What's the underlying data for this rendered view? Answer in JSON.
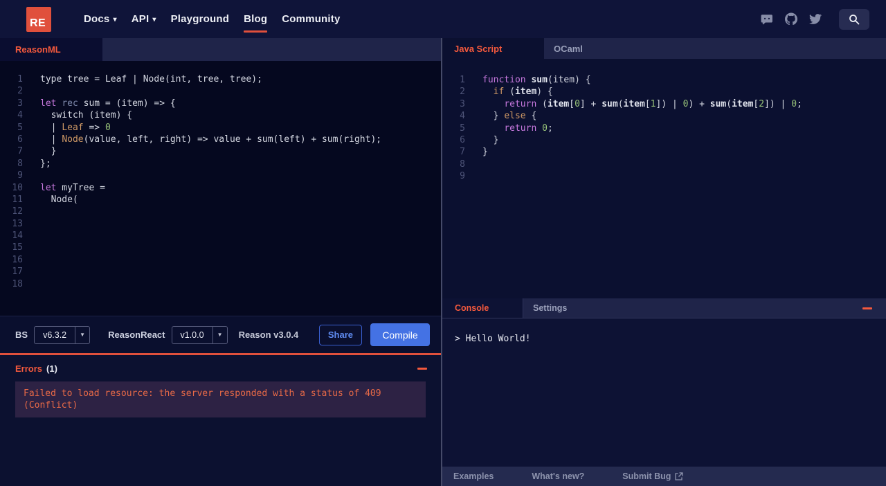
{
  "navbar": {
    "logo_text": "RE",
    "items": [
      {
        "label": "Docs",
        "dropdown": true,
        "active": false
      },
      {
        "label": "API",
        "dropdown": true,
        "active": false
      },
      {
        "label": "Playground",
        "dropdown": false,
        "active": false
      },
      {
        "label": "Blog",
        "dropdown": false,
        "active": true
      },
      {
        "label": "Community",
        "dropdown": false,
        "active": false
      }
    ],
    "icons": [
      "discord-icon",
      "github-icon",
      "twitter-icon",
      "search-icon"
    ]
  },
  "left": {
    "tabs": [
      {
        "label": "ReasonML",
        "active": true
      }
    ],
    "editor": {
      "language": "reason",
      "lines": [
        [
          [
            "p",
            "type tree = Leaf | Node(int, tree, tree);"
          ]
        ],
        [],
        [
          [
            "k",
            "let"
          ],
          [
            "p",
            " "
          ],
          [
            "r",
            "rec"
          ],
          [
            "p",
            " sum = (item) => {"
          ]
        ],
        [
          [
            "p",
            "  switch (item) {"
          ]
        ],
        [
          [
            "p",
            "  | "
          ],
          [
            "o",
            "Leaf"
          ],
          [
            "p",
            " => "
          ],
          [
            "n",
            "0"
          ]
        ],
        [
          [
            "p",
            "  | "
          ],
          [
            "o",
            "Node"
          ],
          [
            "p",
            "(value, left, right) => value + sum(left) + sum(right);"
          ]
        ],
        [
          [
            "p",
            "  }"
          ]
        ],
        [
          [
            "p",
            "};"
          ]
        ],
        [],
        [
          [
            "k",
            "let"
          ],
          [
            "p",
            " myTree ="
          ]
        ],
        [
          [
            "p",
            "  Node("
          ]
        ],
        [],
        [],
        [],
        [],
        [],
        [],
        []
      ]
    },
    "toolbar": {
      "bs_label": "BS",
      "bs_version": "v6.3.2",
      "reasonreact_label": "ReasonReact",
      "reasonreact_version": "v1.0.0",
      "reason_version": "Reason v3.0.4",
      "share_label": "Share",
      "compile_label": "Compile"
    },
    "errors": {
      "title": "Errors",
      "count": "(1)",
      "message_line1": "Failed to load resource: the server responded with a status of 409",
      "message_line2": "(Conflict)"
    }
  },
  "right": {
    "tabs": [
      {
        "label": "Java Script",
        "active": true
      },
      {
        "label": "OCaml",
        "active": false
      }
    ],
    "editor": {
      "language": "javascript",
      "lines": [
        [
          [
            "k",
            "function"
          ],
          [
            "p",
            " "
          ],
          [
            "b",
            "sum"
          ],
          [
            "p",
            "(item) {"
          ]
        ],
        [
          [
            "p",
            "  "
          ],
          [
            "o",
            "if"
          ],
          [
            "p",
            " ("
          ],
          [
            "b",
            "item"
          ],
          [
            "p",
            ") {"
          ]
        ],
        [
          [
            "p",
            "    "
          ],
          [
            "k",
            "return"
          ],
          [
            "p",
            " ("
          ],
          [
            "b",
            "item"
          ],
          [
            "p",
            "["
          ],
          [
            "n",
            "0"
          ],
          [
            "p",
            "] + "
          ],
          [
            "b",
            "sum"
          ],
          [
            "p",
            "("
          ],
          [
            "b",
            "item"
          ],
          [
            "p",
            "["
          ],
          [
            "n",
            "1"
          ],
          [
            "p",
            "]) | "
          ],
          [
            "n",
            "0"
          ],
          [
            "p",
            ") + "
          ],
          [
            "b",
            "sum"
          ],
          [
            "p",
            "("
          ],
          [
            "b",
            "item"
          ],
          [
            "p",
            "["
          ],
          [
            "n",
            "2"
          ],
          [
            "p",
            "]) | "
          ],
          [
            "n",
            "0"
          ],
          [
            "p",
            ";"
          ]
        ],
        [
          [
            "p",
            "  } "
          ],
          [
            "o",
            "else"
          ],
          [
            "p",
            " {"
          ]
        ],
        [
          [
            "p",
            "    "
          ],
          [
            "k",
            "return"
          ],
          [
            "p",
            " "
          ],
          [
            "n",
            "0"
          ],
          [
            "p",
            ";"
          ]
        ],
        [
          [
            "p",
            "  }"
          ]
        ],
        [
          [
            "p",
            "}"
          ]
        ],
        [],
        []
      ]
    },
    "console": {
      "tabs": [
        {
          "label": "Console",
          "active": true
        },
        {
          "label": "Settings",
          "active": false
        }
      ],
      "output": "> Hello World!"
    },
    "footer": {
      "items": [
        "Examples",
        "What's new?",
        "Submit Bug"
      ]
    }
  },
  "colors": {
    "accent_orange": "#f4593d",
    "brand_red": "#e0503c",
    "compile_blue": "#4472e4",
    "share_blue": "#5f8bf0",
    "error_text": "#e96a47",
    "error_box_bg": "#2d2244"
  }
}
